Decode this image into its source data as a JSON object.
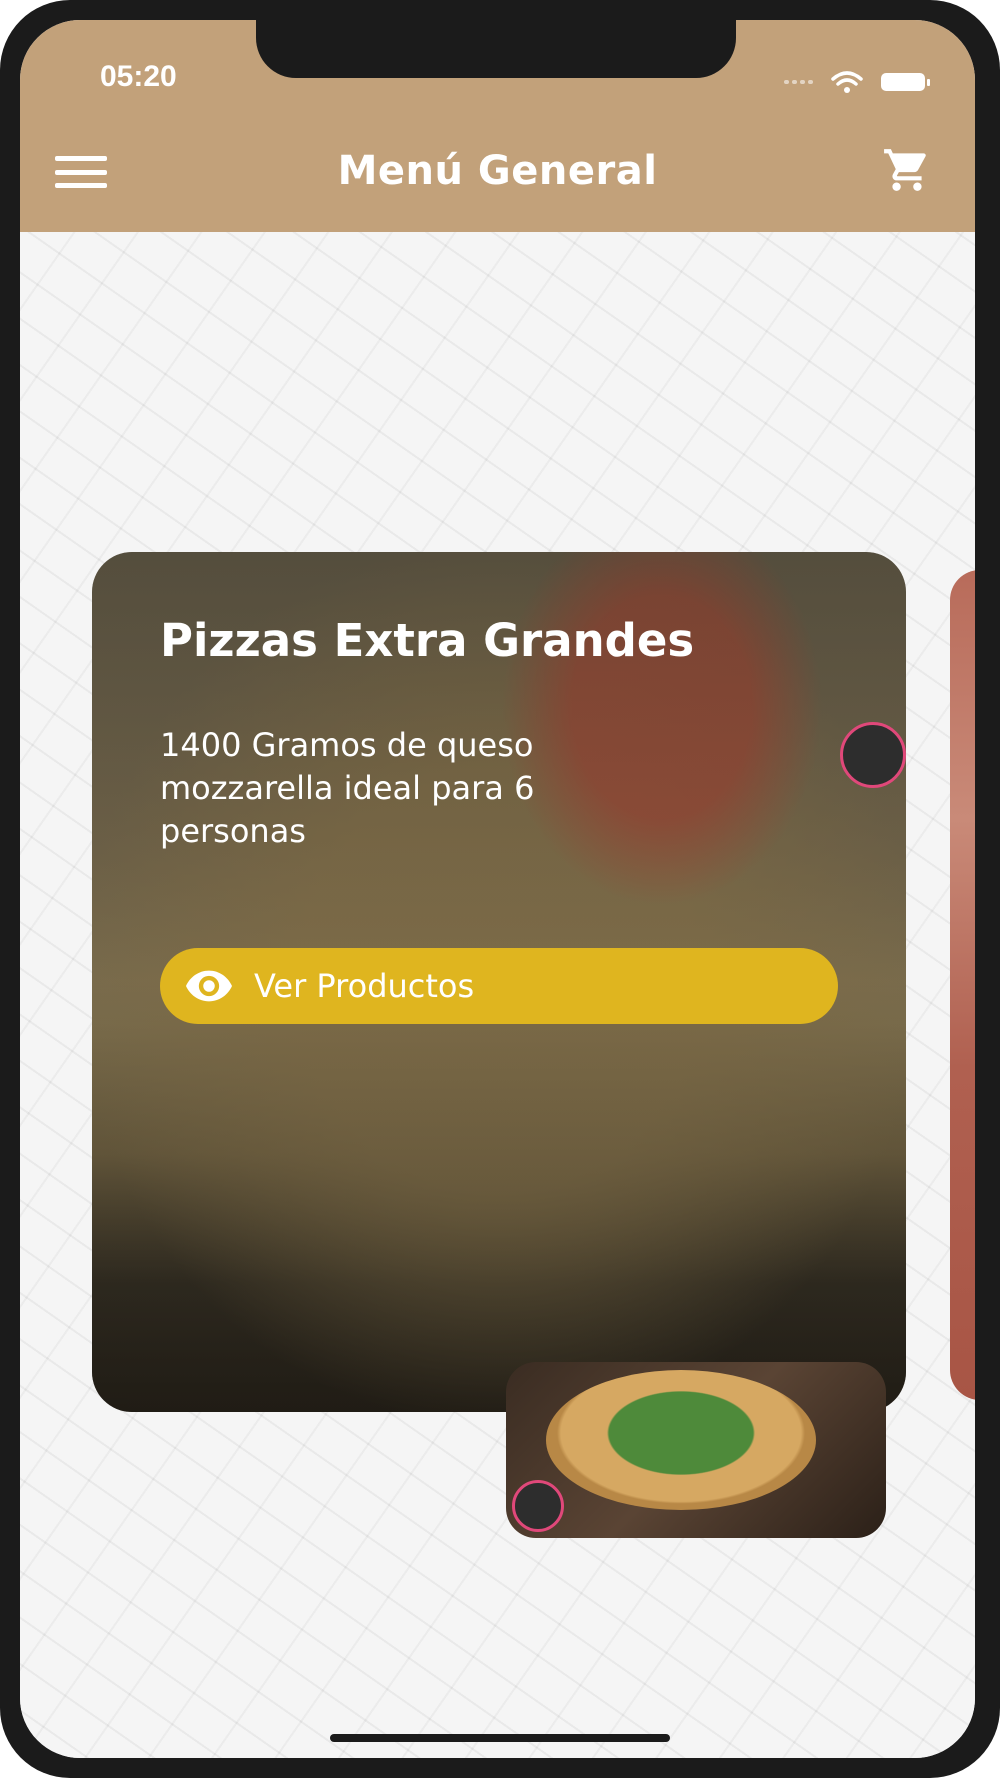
{
  "status_bar": {
    "time": "05:20"
  },
  "header": {
    "title": "Menú General",
    "background_color": "#c2a17a"
  },
  "icons": {
    "menu": "hamburger-menu-icon",
    "cart": "shopping-cart-icon",
    "wifi": "wifi-icon",
    "battery": "battery-icon",
    "eye": "eye-icon"
  },
  "category_card": {
    "title": "Pizzas Extra Grandes",
    "description": "1400 Gramos de queso mozzarella ideal para 6 personas",
    "button_label": "Ver Productos",
    "button_color": "#dfb51f"
  }
}
